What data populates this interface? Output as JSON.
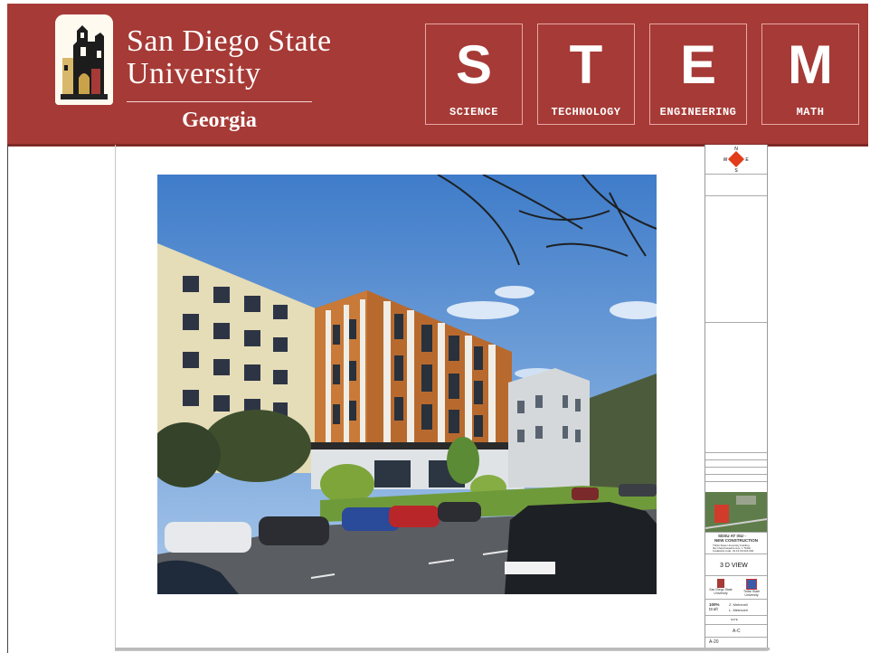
{
  "header": {
    "university_line1": "San Diego State",
    "university_line2": "University",
    "campus": "Georgia",
    "crest_icon": "sdsu-tower-crest",
    "background_color": "#a63a36",
    "stem_tiles": [
      {
        "letter": "S",
        "word": "SCIENCE"
      },
      {
        "letter": "T",
        "word": "TECHNOLOGY"
      },
      {
        "letter": "E",
        "word": "ENGINEERING"
      },
      {
        "letter": "M",
        "word": "MATH"
      }
    ]
  },
  "drawing": {
    "image_subject": "rendering of new building",
    "title_block": {
      "compass": {
        "n": "N",
        "s": "S",
        "e": "E",
        "w": "W"
      },
      "project_line1": "SDSU AT ISU -",
      "project_line2": "NEW CONSTRUCTION",
      "address_line1": "Tbilisi State University building",
      "address_line2": "Ilia Chavchavadze Ave, 1 Tbilisi",
      "address_line3": "Cadastral code: 01.14.03.024.002",
      "sheet_title": "3 D VIEW",
      "logo_left": "San Diego State University",
      "logo_right": "Tbilisi State University",
      "status": "100%",
      "status_sub": "Draft",
      "person1": "Z. Metreveli",
      "person2": "L. Metreveli",
      "date_label": "DATE",
      "scale_value": "A-C",
      "sheet_no": "A-20"
    }
  }
}
